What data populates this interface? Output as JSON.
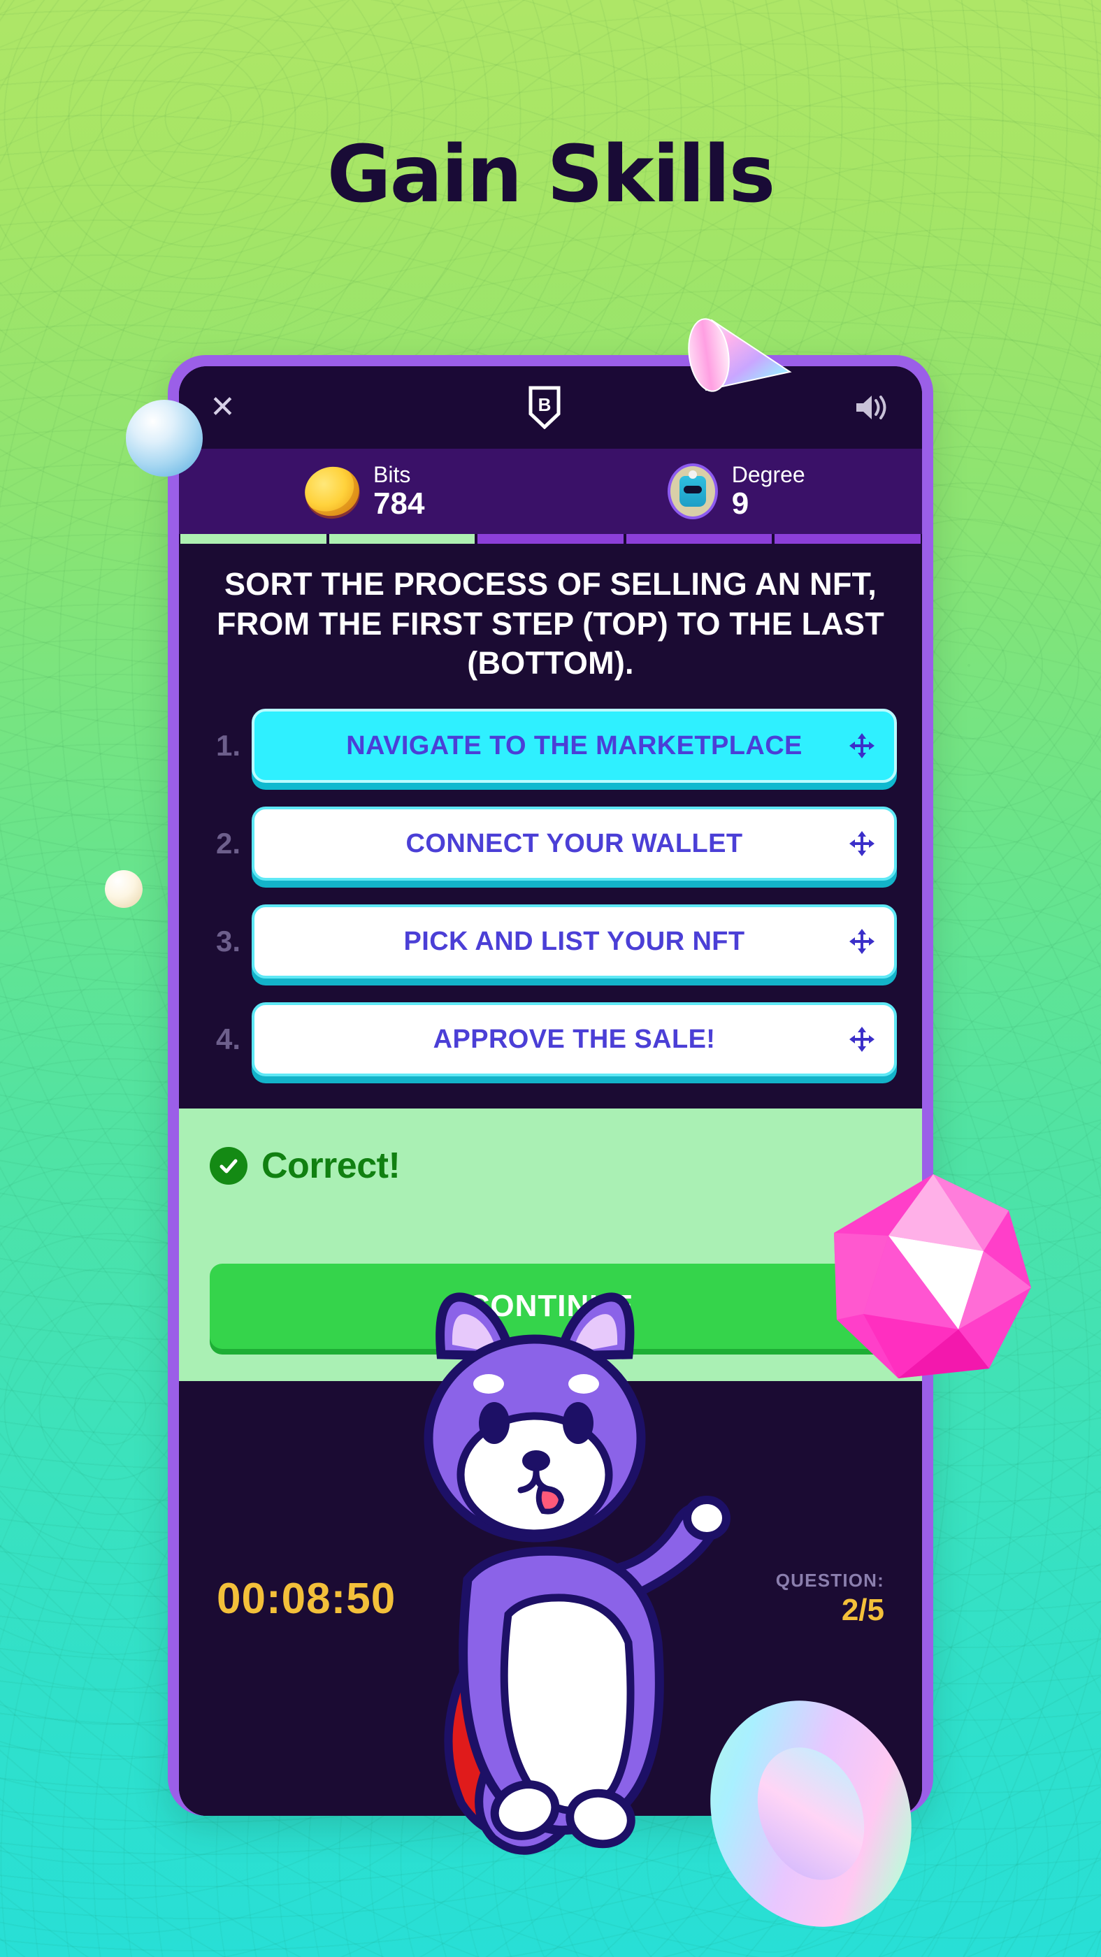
{
  "page": {
    "headline": "Gain Skills",
    "headline_color": "#190b36",
    "bg_top_color": "#aee667",
    "bg_bottom_color": "#28dfd6"
  },
  "phone": {
    "frame_color": "#9b5fe8",
    "screen_color": "#05000f"
  },
  "topbar": {
    "close_icon": "close-x-icon",
    "logo_icon": "b-shield-logo-icon",
    "sound_icon": "speaker-volume-icon"
  },
  "stats": [
    {
      "icon": "gold-coin-icon",
      "label": "Bits",
      "value": "784"
    },
    {
      "icon": "robot-avatar-icon",
      "label": "Degree",
      "value": "9"
    }
  ],
  "progress": {
    "total": 5,
    "completed": 2,
    "done_color": "#aef0b2",
    "todo_color": "#8c3fd9"
  },
  "question": {
    "prompt": "SORT THE PROCESS OF SELLING AN NFT, FROM THE FIRST STEP (TOP) TO THE LAST (BOTTOM).",
    "options": [
      {
        "num": "1.",
        "label": "NAVIGATE TO THE MARKETPLACE",
        "state": "active",
        "handle_icon": "drag-move-icon"
      },
      {
        "num": "2.",
        "label": "CONNECT YOUR WALLET",
        "state": "normal",
        "handle_icon": "drag-move-icon"
      },
      {
        "num": "3.",
        "label": "PICK AND LIST YOUR NFT",
        "state": "normal",
        "handle_icon": "drag-move-icon"
      },
      {
        "num": "4.",
        "label": "APPROVE THE SALE!",
        "state": "normal",
        "handle_icon": "drag-move-icon"
      }
    ]
  },
  "result": {
    "icon": "check-circle-icon",
    "status": "Correct!",
    "status_color": "#118011",
    "panel_color": "#aaf0b4",
    "continue_label": "CONTINUE",
    "continue_color": "#35d44b"
  },
  "footer": {
    "timer": "00:08:50",
    "timer_color": "#f3c03a",
    "question_label": "QUESTION:",
    "question_value": "2/5"
  },
  "decorations": [
    {
      "name": "iridescent-cone",
      "color": "#ff8fe0"
    },
    {
      "name": "blue-glass-sphere",
      "color": "#a9d8f2"
    },
    {
      "name": "cream-sphere",
      "color": "#f2e6c6"
    },
    {
      "name": "pink-gem",
      "color": "#ff3ec9"
    },
    {
      "name": "iridescent-torus",
      "color": "#9ff2d8"
    },
    {
      "name": "shiba-mascot",
      "color": "#8b5cf6"
    }
  ]
}
